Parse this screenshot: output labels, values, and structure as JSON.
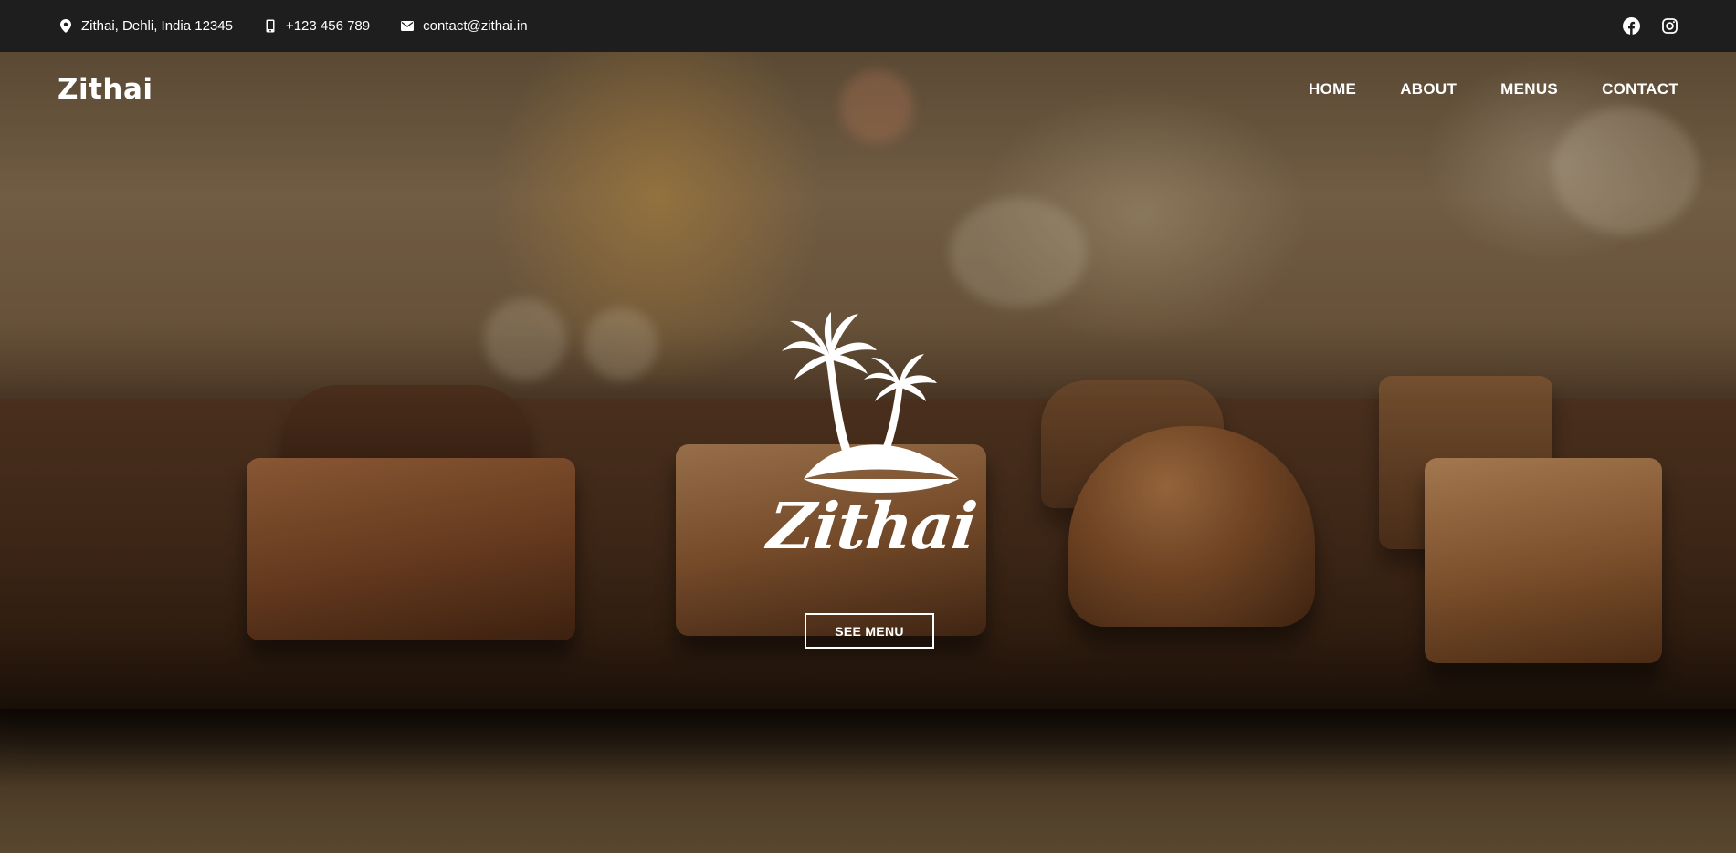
{
  "topbar": {
    "address": "Zithai, Dehli, India 12345",
    "phone": "+123 456 789",
    "email": "contact@zithai.in",
    "icons": {
      "address": "map-pin-icon",
      "phone": "mobile-phone-icon",
      "email": "envelope-icon",
      "social": [
        "facebook-icon",
        "instagram-icon"
      ]
    }
  },
  "nav": {
    "brand": "Zithai",
    "items": [
      {
        "label": "HOME"
      },
      {
        "label": "ABOUT"
      },
      {
        "label": "MENUS"
      },
      {
        "label": "CONTACT"
      }
    ]
  },
  "hero": {
    "logo_icon": "palm-tree-island-icon",
    "logo_text": "Zithai",
    "button_label": "SEE MENU"
  },
  "colors": {
    "topbar_bg": "#1e1e1e",
    "text": "#ffffff"
  }
}
